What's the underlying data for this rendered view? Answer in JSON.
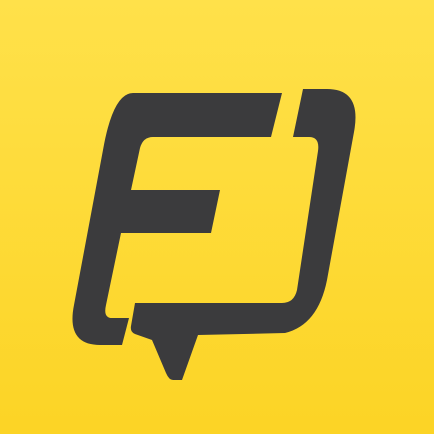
{
  "app_icon": {
    "icon": "stylized-letter-e-chat-bubble-logo-icon",
    "colors": {
      "background_top": "#FFE14A",
      "background_bottom": "#FCD425",
      "glyph": "#3B3B3D"
    }
  }
}
